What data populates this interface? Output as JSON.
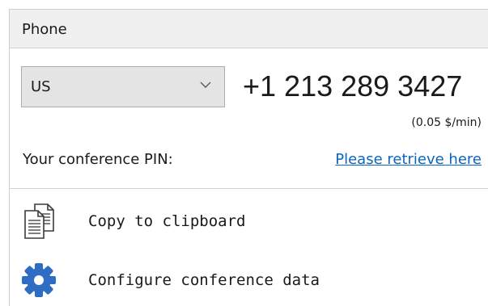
{
  "panel": {
    "title": "Phone"
  },
  "country_select": {
    "selected": "US"
  },
  "dial_in": {
    "number": "+1 213 289 3427",
    "rate": "(0.05 $/min)"
  },
  "pin": {
    "label": "Your conference PIN:",
    "link_text": "Please retrieve here"
  },
  "actions": [
    {
      "label": "Copy to clipboard",
      "icon": "clipboard-copy-icon"
    },
    {
      "label": "Configure conference data",
      "icon": "gear-icon"
    }
  ],
  "colors": {
    "link": "#0a66c2",
    "gear": "#2f6cc4",
    "header_bg": "#f0f0f0"
  }
}
